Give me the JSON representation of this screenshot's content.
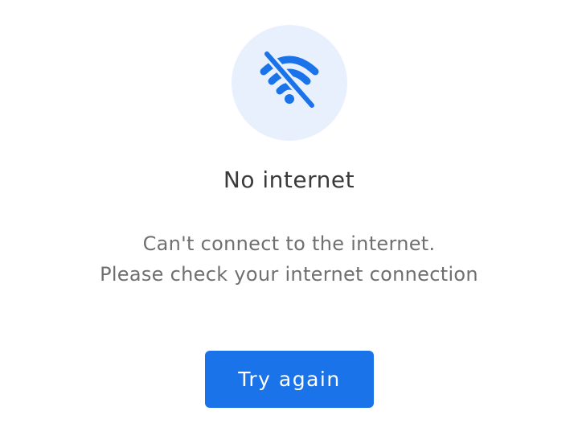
{
  "offline_screen": {
    "icon": "wifi-off-icon",
    "title": "No internet",
    "message_line1": "Can't connect to the internet.",
    "message_line2": "Please check your internet connection",
    "retry_label": "Try again"
  },
  "colors": {
    "accent": "#1a73e8",
    "icon_bg": "#e8f0fe",
    "title": "#3a3a3a",
    "message": "#6f6f6f"
  }
}
